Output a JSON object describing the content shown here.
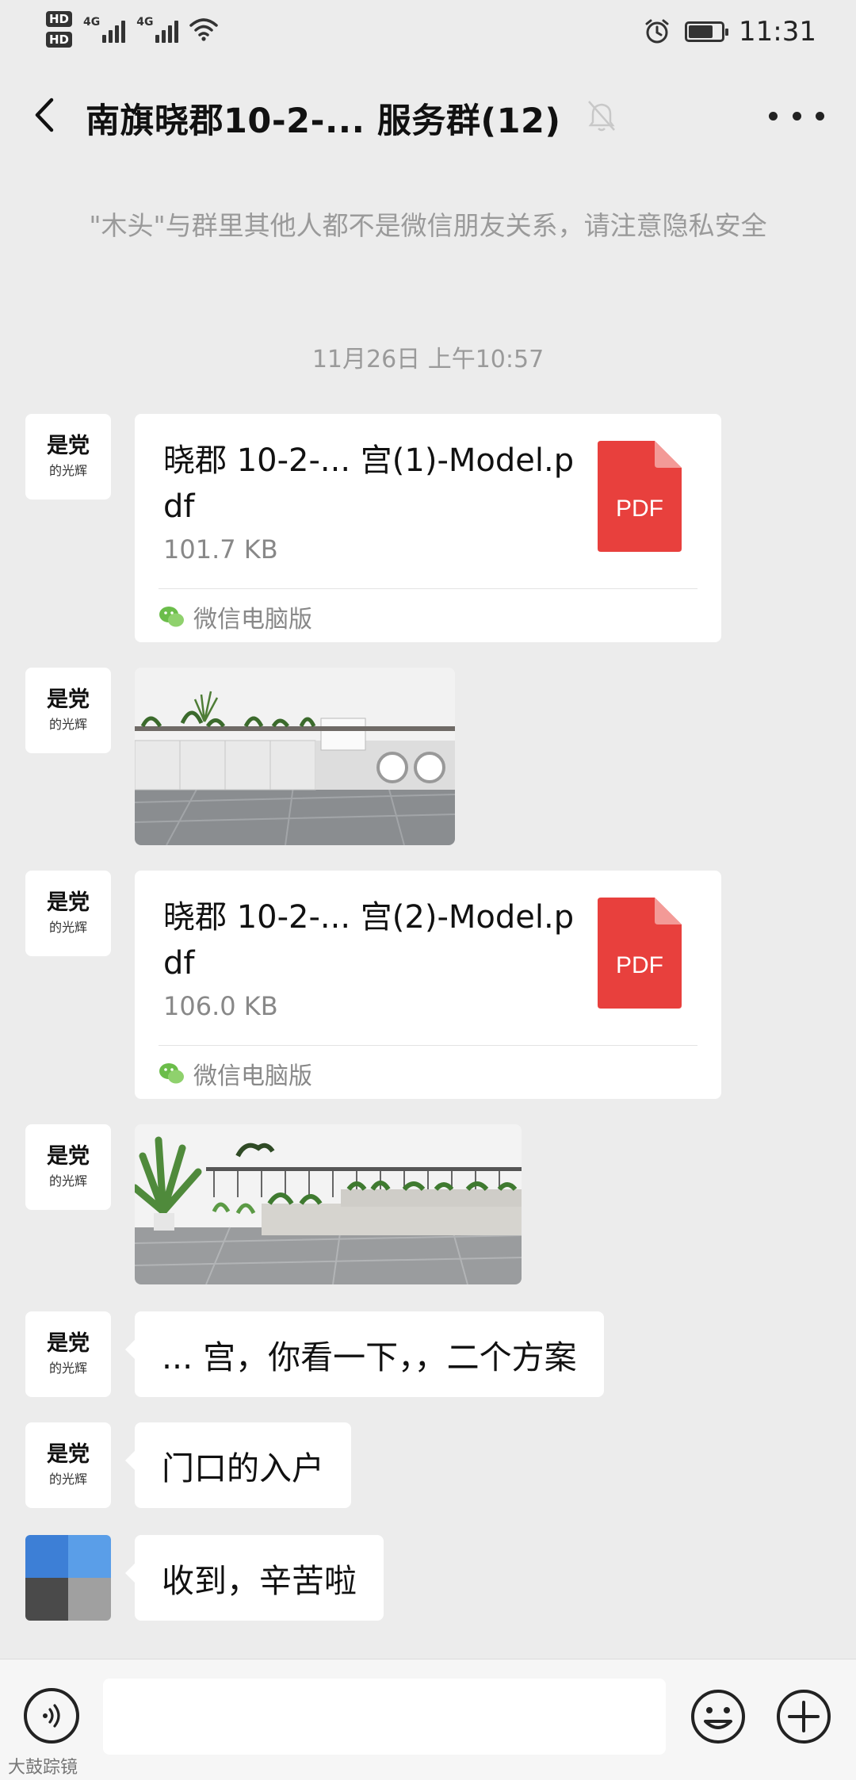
{
  "status_bar": {
    "hd1": "HD",
    "hd2": "HD",
    "net1": "4G",
    "net2": "4G",
    "time": "11:31",
    "battery_level": 0.75
  },
  "nav": {
    "title": "南旗晓郡10-2-... 服务群(12)",
    "back_icon": "chevron-left-icon",
    "mute_icon": "bell-off-icon",
    "more_icon": "more-icon"
  },
  "notice": "\"木头\"与群里其他人都不是微信朋友关系，请注意隐私安全",
  "timestamp": "11月26日 上午10:57",
  "messages": [
    {
      "type": "file",
      "avatar": {
        "line1": "是党",
        "line2": "的光辉"
      },
      "file_name": "晓郡 10-2-... 宫(1)-Model.pdf",
      "file_size": "101.7 KB",
      "file_badge": "PDF",
      "source": "微信电脑版"
    },
    {
      "type": "image",
      "avatar": {
        "line1": "是党",
        "line2": "的光辉"
      },
      "image_desc": "balcony-laundry-render"
    },
    {
      "type": "file",
      "avatar": {
        "line1": "是党",
        "line2": "的光辉"
      },
      "file_name": "晓郡 10-2-... 宫(2)-Model.pdf",
      "file_size": "106.0 KB",
      "file_badge": "PDF",
      "source": "微信电脑版"
    },
    {
      "type": "image",
      "avatar": {
        "line1": "是党",
        "line2": "的光辉"
      },
      "image_desc": "balcony-garden-render"
    },
    {
      "type": "text",
      "avatar": {
        "line1": "是党",
        "line2": "的光辉"
      },
      "text": "... 宫，你看一下，，二个方案"
    },
    {
      "type": "text",
      "avatar": {
        "line1": "是党",
        "line2": "的光辉"
      },
      "text": "门口的入户"
    },
    {
      "type": "text",
      "avatar": {
        "mosaic": [
          "#3d7fd6",
          "#5a9ee8",
          "#4a4a4a",
          "#a0a0a0"
        ]
      },
      "text": "收到，辛苦啦"
    }
  ],
  "input_bar": {
    "placeholder": "",
    "voice_icon": "voice-icon",
    "emoji_icon": "emoji-icon",
    "plus_icon": "plus-icon"
  },
  "watermark": "大鼓踪镜",
  "colors": {
    "background": "#ececec",
    "pdf_red": "#e8403d",
    "wechat_green": "#6bbd4a"
  }
}
